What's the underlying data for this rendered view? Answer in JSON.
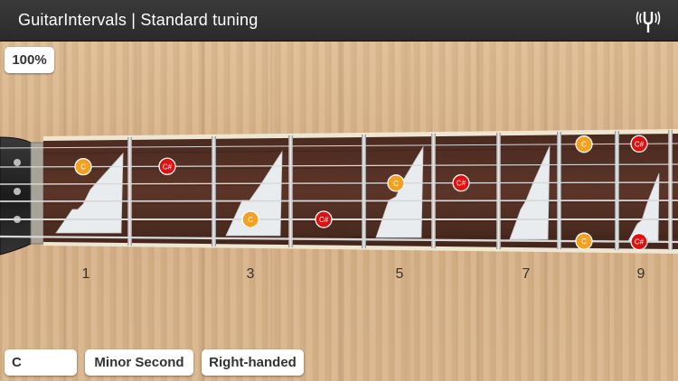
{
  "header": {
    "title": "GuitarIntervals | Standard tuning",
    "tuner_icon": "tuning-fork-icon"
  },
  "zoom": {
    "label": "100%"
  },
  "controls": {
    "key_value": "C",
    "interval_value": "Minor Second",
    "handedness_value": "Right-handed"
  },
  "fretboard": {
    "fret_markers": [
      {
        "fret": 1,
        "label": "1"
      },
      {
        "fret": 3,
        "label": "3"
      },
      {
        "fret": 5,
        "label": "5"
      },
      {
        "fret": 7,
        "label": "7"
      },
      {
        "fret": 9,
        "label": "9"
      }
    ],
    "root_color": "#f4a020",
    "interval_color": "#e01010",
    "notes": [
      {
        "string": 2,
        "fret": 1,
        "label": "C",
        "role": "root"
      },
      {
        "string": 2,
        "fret": 2,
        "label": "C#",
        "role": "interval"
      },
      {
        "string": 5,
        "fret": 3,
        "label": "C",
        "role": "root"
      },
      {
        "string": 5,
        "fret": 4,
        "label": "C#",
        "role": "interval"
      },
      {
        "string": 3,
        "fret": 5,
        "label": "C",
        "role": "root"
      },
      {
        "string": 3,
        "fret": 6,
        "label": "C#",
        "role": "interval"
      },
      {
        "string": 1,
        "fret": 8,
        "label": "C",
        "role": "root"
      },
      {
        "string": 1,
        "fret": 9,
        "label": "C#",
        "role": "interval"
      },
      {
        "string": 6,
        "fret": 8,
        "label": "C",
        "role": "root"
      },
      {
        "string": 6,
        "fret": 9,
        "label": "C#",
        "role": "interval"
      }
    ]
  }
}
